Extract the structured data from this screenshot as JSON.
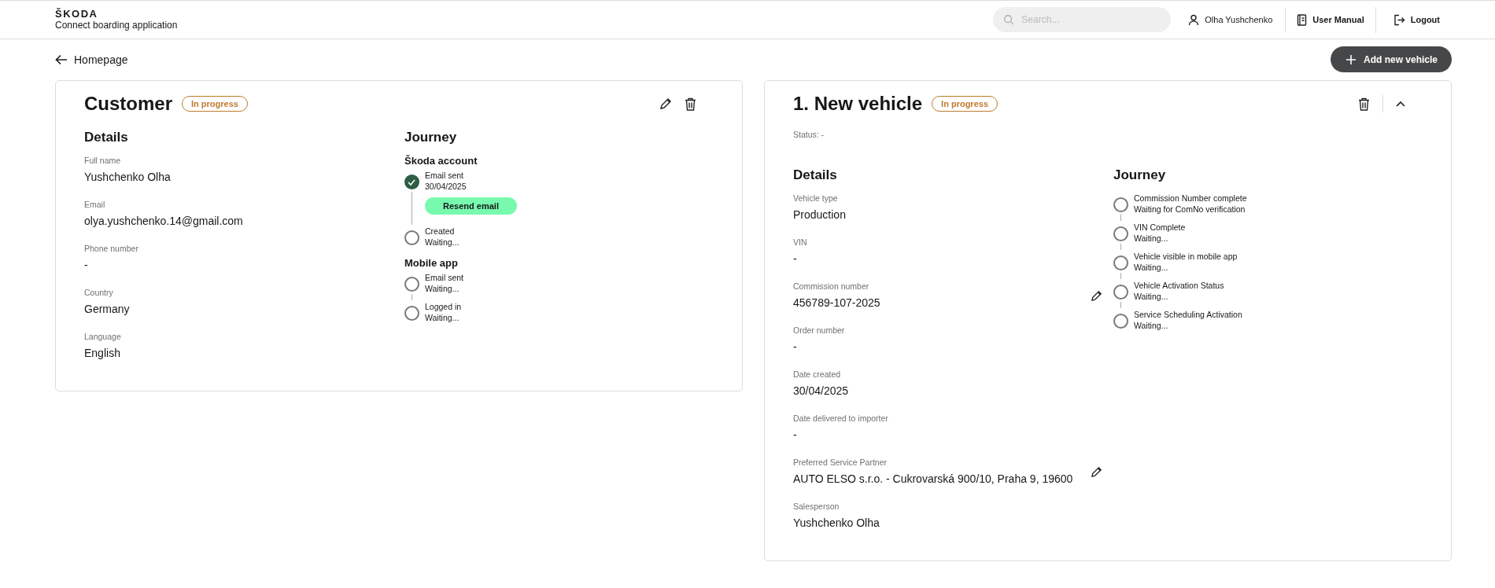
{
  "header": {
    "brand": "ŠKODA",
    "app_name": "Connect boarding application",
    "search": {
      "placeholder": "Search..."
    },
    "user": "Olha Yushchenko",
    "manual": "User Manual",
    "logout": "Logout"
  },
  "nav": {
    "back": "Homepage",
    "add_button": "Add new vehicle"
  },
  "customer": {
    "title": "Customer",
    "status": "In progress",
    "details_heading": "Details",
    "fields": [
      {
        "label": "Full name",
        "value": "Yushchenko Olha"
      },
      {
        "label": "Email",
        "value": "olya.yushchenko.14@gmail.com"
      },
      {
        "label": "Phone number",
        "value": "-"
      },
      {
        "label": "Country",
        "value": "Germany"
      },
      {
        "label": "Language",
        "value": "English"
      }
    ],
    "journey_heading": "Journey",
    "journey_groups": [
      {
        "title": "Škoda account",
        "steps": [
          {
            "name": "Email sent",
            "status": "30/04/2025",
            "done": true,
            "action": "Resend email"
          },
          {
            "name": "Created",
            "status": "Waiting...",
            "done": false
          }
        ]
      },
      {
        "title": "Mobile app",
        "steps": [
          {
            "name": "Email sent",
            "status": "Waiting...",
            "done": false
          },
          {
            "name": "Logged in",
            "status": "Waiting...",
            "done": false
          }
        ]
      }
    ]
  },
  "vehicle": {
    "title": "1. New vehicle",
    "status": "In progress",
    "status_line": "Status: -",
    "expanded": true,
    "details_heading": "Details",
    "fields": [
      {
        "label": "Vehicle type",
        "value": "Production",
        "editable": false
      },
      {
        "label": "VIN",
        "value": "-",
        "editable": false
      },
      {
        "label": "Commission number",
        "value": "456789-107-2025",
        "editable": true
      },
      {
        "label": "Order number",
        "value": "-",
        "editable": false
      },
      {
        "label": "Date created",
        "value": "30/04/2025",
        "editable": false
      },
      {
        "label": "Date delivered to importer",
        "value": "-",
        "editable": false
      },
      {
        "label": "Preferred Service Partner",
        "value": "AUTO ELSO s.r.o. - Cukrovarská 900/10, Praha 9, 19600",
        "editable": true
      },
      {
        "label": "Salesperson",
        "value": "Yushchenko Olha",
        "editable": false
      }
    ],
    "journey_heading": "Journey",
    "steps": [
      {
        "name": "Commission Number complete",
        "status": "Waiting for ComNo verification",
        "done": false
      },
      {
        "name": "VIN Complete",
        "status": "Waiting...",
        "done": false
      },
      {
        "name": "Vehicle visible in mobile app",
        "status": "Waiting...",
        "done": false
      },
      {
        "name": "Vehicle Activation Status",
        "status": "Waiting...",
        "done": false
      },
      {
        "name": "Service Scheduling Activation",
        "status": "Waiting...",
        "done": false
      }
    ]
  }
}
